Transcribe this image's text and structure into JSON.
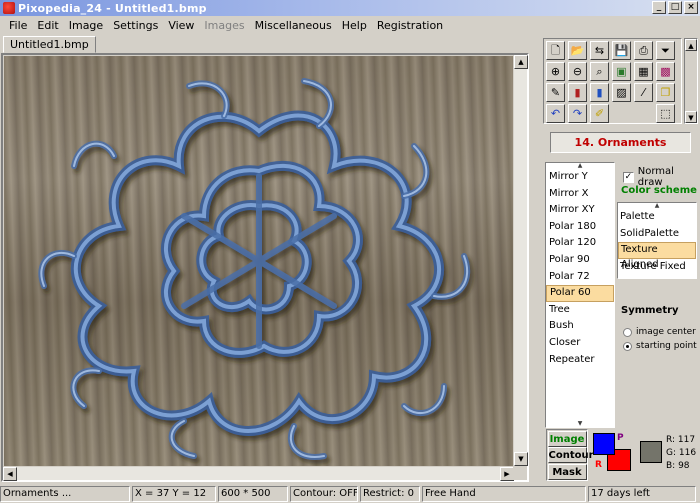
{
  "window": {
    "title": "Pixopedia_24 - Untitled1.bmp"
  },
  "menu": [
    "File",
    "Edit",
    "Image",
    "Settings",
    "View",
    "Images",
    "Miscellaneous",
    "Help",
    "Registration"
  ],
  "menu_disabled": [
    "Images"
  ],
  "document": {
    "tab": "Untitled1.bmp"
  },
  "toolbar": {
    "buttons": [
      "new-file-icon",
      "open-file-icon",
      "reopen-icon",
      "save-icon",
      "print-icon",
      "filter-icon",
      "zoom-in-icon",
      "zoom-out-icon",
      "zoom-fit-icon",
      "image-view-icon",
      "grid-icon",
      "pattern-icon",
      "brush-icon",
      "bars-icon",
      "paints-icon",
      "picture-icon",
      "wand-icon",
      "copy-icon",
      "undo-icon",
      "redo-icon",
      "pen-icon",
      "selection-icon"
    ]
  },
  "mode": {
    "label": "14. Ornaments"
  },
  "symmetry_list": {
    "items": [
      "Mirror Y",
      "Mirror X",
      "Mirror XY",
      "Polar 180",
      "Polar 120",
      "Polar 90",
      "Polar 72",
      "Polar 60",
      "Tree",
      "Bush",
      "Closer",
      "Repeater"
    ],
    "selected": "Polar 60"
  },
  "normal_draw": {
    "label": "Normal draw",
    "checked": true
  },
  "color_scheme": {
    "label": "Color scheme",
    "items": [
      "Palette",
      "SolidPalette",
      "Texture Aligned",
      "Texture Fixed"
    ],
    "selected": "Texture Aligned"
  },
  "symmetry": {
    "label": "Symmetry",
    "options": [
      "image center",
      "starting point"
    ],
    "selected": "starting point"
  },
  "image_buttons": [
    "Image",
    "Contour",
    "Mask"
  ],
  "colors": {
    "primary": "#0000ff",
    "secondary": "#ff0000",
    "picked": "#75746a",
    "p_label": "P",
    "r_label": "R",
    "r": "R: 117",
    "g": "G: 116",
    "b": "B: 98"
  },
  "status": {
    "mode": "Ornaments ...",
    "coords": "X = 37 Y = 12",
    "size": "600 * 500",
    "contour": "Contour: OFF",
    "restrict": "Restrict: 0",
    "tool": "Free Hand",
    "trial": "17 days left"
  }
}
